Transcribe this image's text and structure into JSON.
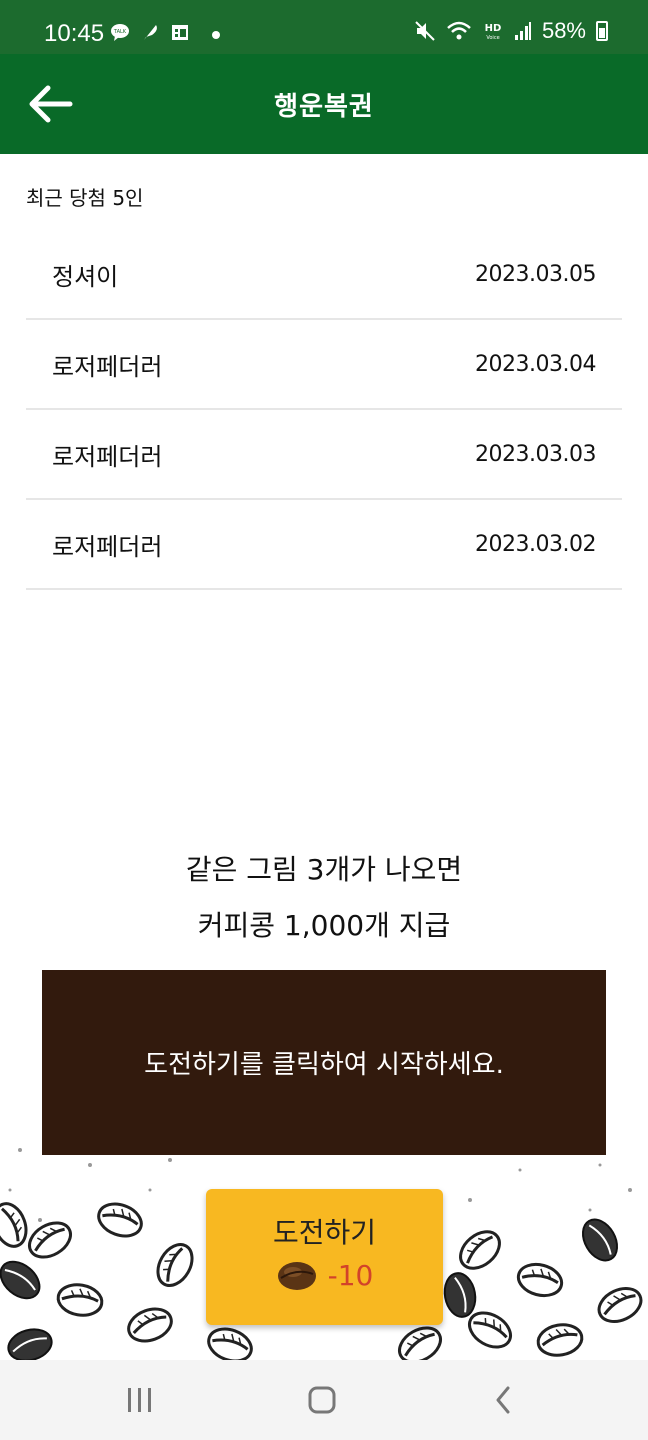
{
  "status_bar": {
    "time": "10:45",
    "left_icons": [
      "talk-icon",
      "feather-icon",
      "calendar-icon",
      "dot-icon"
    ],
    "right_icons": [
      "mute-icon",
      "wifi-icon",
      "hd-voice-icon",
      "signal-icon"
    ],
    "battery": "58%"
  },
  "app_bar": {
    "title": "행운복권",
    "back_icon": "arrow-left-icon"
  },
  "winners": {
    "heading": "최근 당첨 5인",
    "rows": [
      {
        "name": "정셔이",
        "date": "2023.03.05"
      },
      {
        "name": "로저페더러",
        "date": "2023.03.04"
      },
      {
        "name": "로저페더러",
        "date": "2023.03.03"
      },
      {
        "name": "로저페더러",
        "date": "2023.03.02"
      }
    ]
  },
  "prize": {
    "line1": "같은 그림 3개가 나오면",
    "line2": "커피콩 1,000개 지급"
  },
  "game": {
    "message": "도전하기를 클릭하여 시작하세요."
  },
  "challenge_button": {
    "label": "도전하기",
    "cost": "-10",
    "cost_icon": "coffee-bean-icon"
  },
  "nav_bar": {
    "items": [
      "recent-apps-icon",
      "home-icon",
      "back-icon"
    ]
  },
  "colors": {
    "status_bar": "#1c6b2e",
    "app_bar": "#096a28",
    "game_panel": "#321a0d",
    "button": "#f8b821",
    "cost": "#d2432a"
  }
}
